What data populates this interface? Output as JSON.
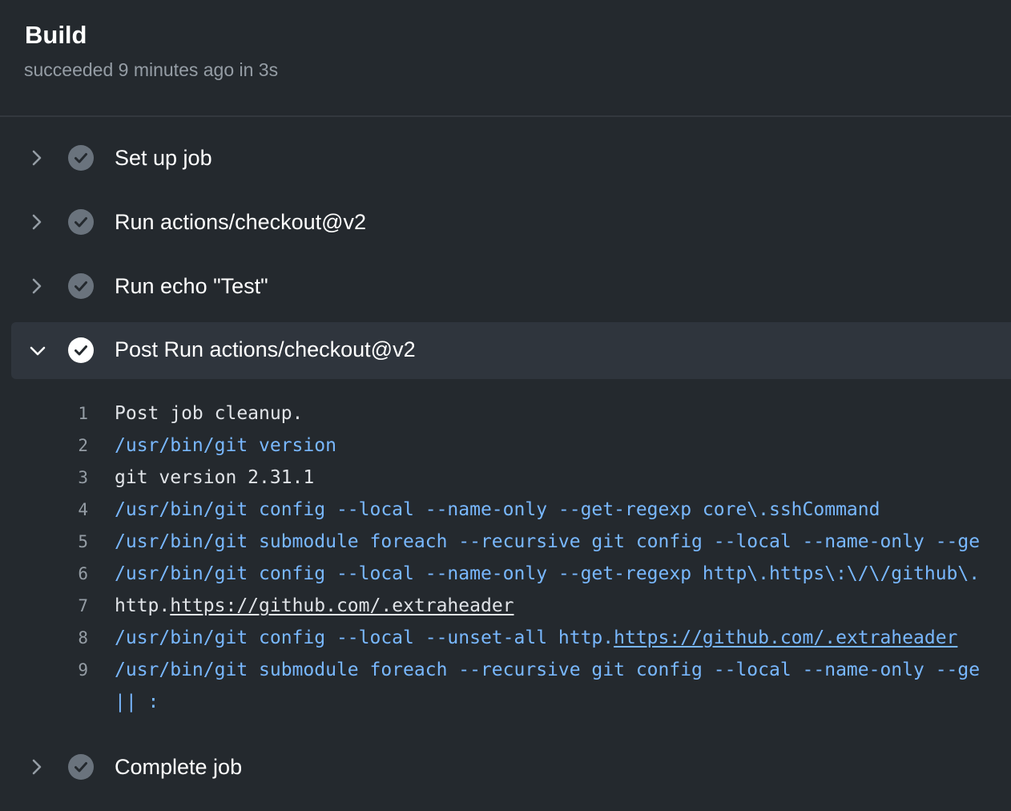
{
  "header": {
    "title": "Build",
    "status": "succeeded 9 minutes ago in 3s"
  },
  "steps": [
    {
      "label": "Set up job",
      "state": "collapsed",
      "icon": "check-circle-icon"
    },
    {
      "label": "Run actions/checkout@v2",
      "state": "collapsed",
      "icon": "check-circle-icon"
    },
    {
      "label": "Run echo \"Test\"",
      "state": "collapsed",
      "icon": "check-circle-icon"
    },
    {
      "label": "Post Run actions/checkout@v2",
      "state": "expanded",
      "icon": "check-circle-icon"
    },
    {
      "label": "Complete job",
      "state": "collapsed",
      "icon": "check-circle-icon"
    }
  ],
  "log": {
    "lines": [
      {
        "n": "1",
        "text": "Post job cleanup."
      },
      {
        "n": "2",
        "text": "/usr/bin/git version"
      },
      {
        "n": "3",
        "text": "git version 2.31.1"
      },
      {
        "n": "4",
        "text": "/usr/bin/git config --local --name-only --get-regexp core\\.sshCommand"
      },
      {
        "n": "5",
        "text": "/usr/bin/git submodule foreach --recursive git config --local --name-only --ge"
      },
      {
        "n": "6",
        "text": "/usr/bin/git config --local --name-only --get-regexp http\\.https\\:\\/\\/github\\."
      },
      {
        "n": "7",
        "prefix": "http.",
        "link": "https://github.com/.extraheader"
      },
      {
        "n": "8",
        "prefix": "/usr/bin/git config --local --unset-all http.",
        "link": "https://github.com/.extraheader"
      },
      {
        "n": "9",
        "text": "/usr/bin/git submodule foreach --recursive git config --local --name-only --ge"
      },
      {
        "n": "",
        "text": "|| :"
      }
    ]
  },
  "colors": {
    "background": "#24292e",
    "expanded_row": "#2f353d",
    "command_text": "#79b8ff",
    "plain_text": "#e1e4e8",
    "muted_text": "#959da5",
    "check_collapsed": "#6a737d",
    "check_expanded": "#ffffff"
  }
}
